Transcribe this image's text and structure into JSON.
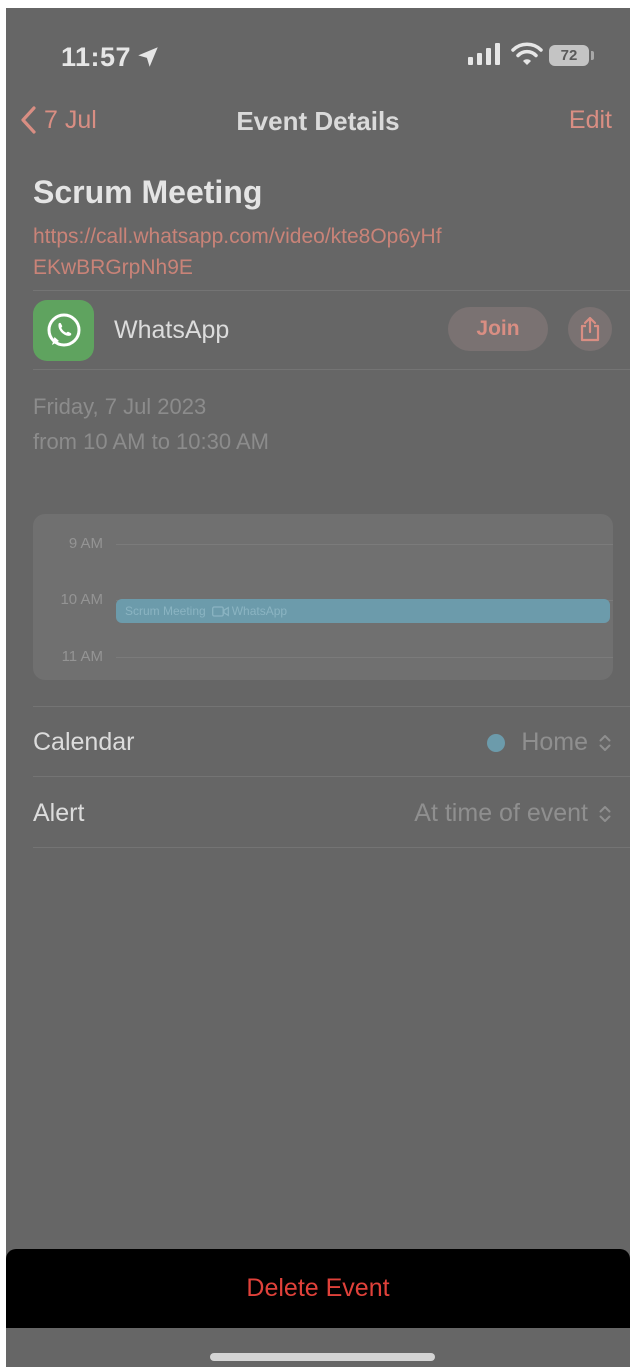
{
  "status_bar": {
    "time": "11:57",
    "battery": "72",
    "icons": [
      "location-arrow-icon",
      "signal-icon",
      "wifi-icon",
      "battery-icon"
    ]
  },
  "nav": {
    "back_label": "7 Jul",
    "title": "Event Details",
    "edit_label": "Edit"
  },
  "event": {
    "title": "Scrum Meeting",
    "url": "https://call.whatsapp.com/video/kte8Op6yHfEKwBRGrpNh9E"
  },
  "video_call": {
    "app_name": "WhatsApp",
    "join_label": "Join"
  },
  "schedule": {
    "date": "Friday, 7 Jul 2023",
    "time_range": "from 10 AM to 10:30 AM"
  },
  "timeline": {
    "hours": [
      "9 AM",
      "10 AM",
      "11 AM"
    ],
    "event_label": "Scrum Meeting",
    "event_app": "WhatsApp"
  },
  "details": {
    "calendar_label": "Calendar",
    "calendar_value": "Home",
    "calendar_color": "#6c9bab",
    "alert_label": "Alert",
    "alert_value": "At time of event"
  },
  "actions": {
    "delete_label": "Delete Event"
  },
  "colors": {
    "accent": "#d98e83",
    "destructive": "#e0413a",
    "background": "#666666"
  }
}
